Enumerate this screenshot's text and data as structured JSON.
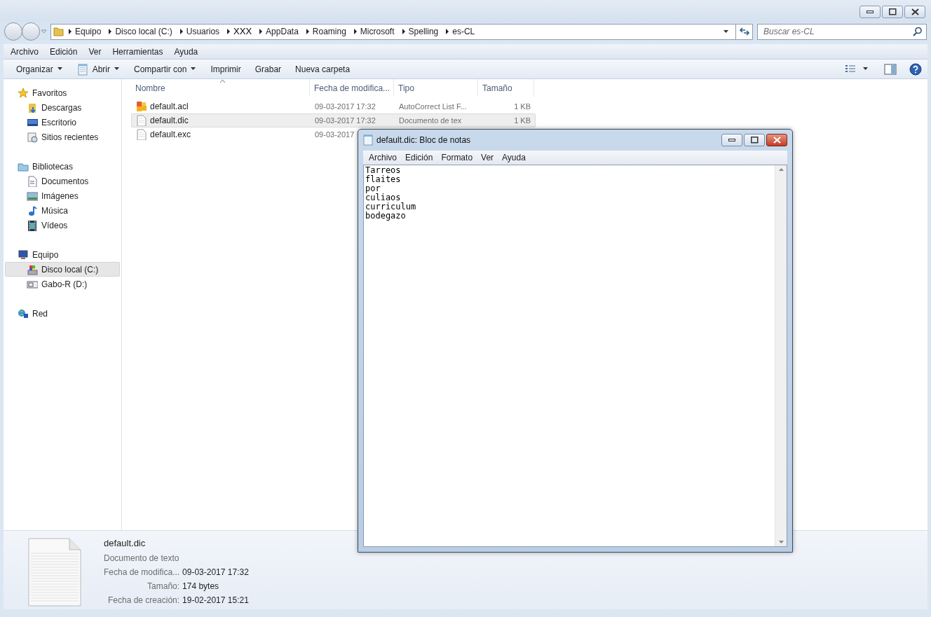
{
  "address": {
    "segments": [
      "Equipo",
      "Disco local (C:)",
      "Usuarios",
      "XXX",
      "AppData",
      "Roaming",
      "Microsoft",
      "Spelling",
      "es-CL"
    ]
  },
  "search": {
    "placeholder": "Buscar es-CL"
  },
  "menu": [
    "Archivo",
    "Edición",
    "Ver",
    "Herramientas",
    "Ayuda"
  ],
  "toolbar": [
    {
      "label": "Organizar",
      "dropdown": true
    },
    {
      "label": "Abrir",
      "dropdown": true
    },
    {
      "label": "Compartir con",
      "dropdown": true
    },
    {
      "label": "Imprimir",
      "dropdown": false
    },
    {
      "label": "Grabar",
      "dropdown": false
    },
    {
      "label": "Nueva carpeta",
      "dropdown": false
    }
  ],
  "sidebar": {
    "groups": [
      {
        "label": "Favoritos",
        "children": [
          {
            "label": "Descargas",
            "selected": false
          },
          {
            "label": "Escritorio",
            "selected": false
          },
          {
            "label": "Sitios recientes",
            "selected": false
          }
        ]
      },
      {
        "label": "Bibliotecas",
        "children": [
          {
            "label": "Documentos",
            "selected": false
          },
          {
            "label": "Imágenes",
            "selected": false
          },
          {
            "label": "Música",
            "selected": false
          },
          {
            "label": "Vídeos",
            "selected": false
          }
        ]
      },
      {
        "label": "Equipo",
        "children": [
          {
            "label": "Disco local (C:)",
            "selected": true
          },
          {
            "label": "Gabo-R (D:)",
            "selected": false
          }
        ]
      },
      {
        "label": "Red"
      }
    ]
  },
  "table": {
    "columns": [
      "Nombre",
      "Fecha de modifica...",
      "Tipo",
      "Tamaño"
    ],
    "rows": [
      {
        "name": "default.acl",
        "date": "09-03-2017 17:32",
        "type": "AutoCorrect List F...",
        "size": "1 KB",
        "selected": false
      },
      {
        "name": "default.dic",
        "date": "09-03-2017 17:32",
        "type": "Documento de tex",
        "size": "1 KB",
        "selected": true
      },
      {
        "name": "default.exc",
        "date": "09-03-2017",
        "selected": false
      }
    ]
  },
  "details": {
    "name": "default.dic",
    "type": "Documento de texto",
    "properties": [
      {
        "label": "Fecha de modifica...",
        "value": "09-03-2017 17:32"
      },
      {
        "label": "Tamaño:",
        "value": "174 bytes"
      },
      {
        "label": "Fecha de creación:",
        "value": "19-02-2017 15:21"
      }
    ]
  },
  "notepad": {
    "title": "default.dic: Bloc de notas",
    "menu": [
      "Archivo",
      "Edición",
      "Formato",
      "Ver",
      "Ayuda"
    ],
    "lines": [
      "Tarreos",
      "flaites",
      "por",
      "culiaos",
      "curriculum",
      "bodegazo"
    ]
  }
}
